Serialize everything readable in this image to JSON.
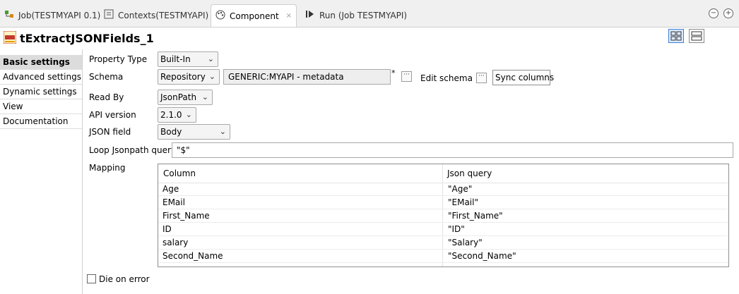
{
  "tabs": [
    {
      "label": "Job(TESTMYAPI 0.1)",
      "icon": "job-icon"
    },
    {
      "label": "Contexts(TESTMYAPI)",
      "icon": "contexts-icon"
    },
    {
      "label": "Component",
      "icon": "palette-icon",
      "active": true,
      "close": "×"
    },
    {
      "label": "Run (Job TESTMYAPI)",
      "icon": "run-icon"
    }
  ],
  "window_controls": {
    "minimize": "−",
    "maximize": "+"
  },
  "component": {
    "title": "tExtractJSONFields_1",
    "icon_text": "JSON"
  },
  "nav": [
    "Basic settings",
    "Advanced settings",
    "Dynamic settings",
    "View",
    "Documentation"
  ],
  "form": {
    "property_type": {
      "label": "Property Type",
      "value": "Built-In"
    },
    "schema": {
      "label": "Schema",
      "value": "Repository",
      "repo_value": "GENERIC:MYAPI - metadata",
      "marker": "*",
      "edit_label": "Edit schema",
      "sync_label": "Sync columns",
      "dots": "···"
    },
    "read_by": {
      "label": "Read By",
      "value": "JsonPath"
    },
    "api_version": {
      "label": "API version",
      "value": "2.1.0"
    },
    "json_field": {
      "label": "JSON field",
      "value": "Body"
    },
    "loop_query": {
      "label": "Loop Jsonpath query",
      "value": "\"$\""
    },
    "mapping": {
      "label": "Mapping"
    },
    "die_on_error": {
      "label": "Die on error",
      "checked": false
    }
  },
  "table": {
    "headers": [
      "Column",
      "Json query"
    ],
    "rows": [
      [
        "Age",
        "\"Age\""
      ],
      [
        "EMail",
        "\"EMail\""
      ],
      [
        "First_Name",
        "\"First_Name\""
      ],
      [
        "ID",
        "\"ID\""
      ],
      [
        "salary",
        "\"Salary\""
      ],
      [
        "Second_Name",
        "\"Second_Name\""
      ]
    ]
  },
  "arrow": "⌄"
}
